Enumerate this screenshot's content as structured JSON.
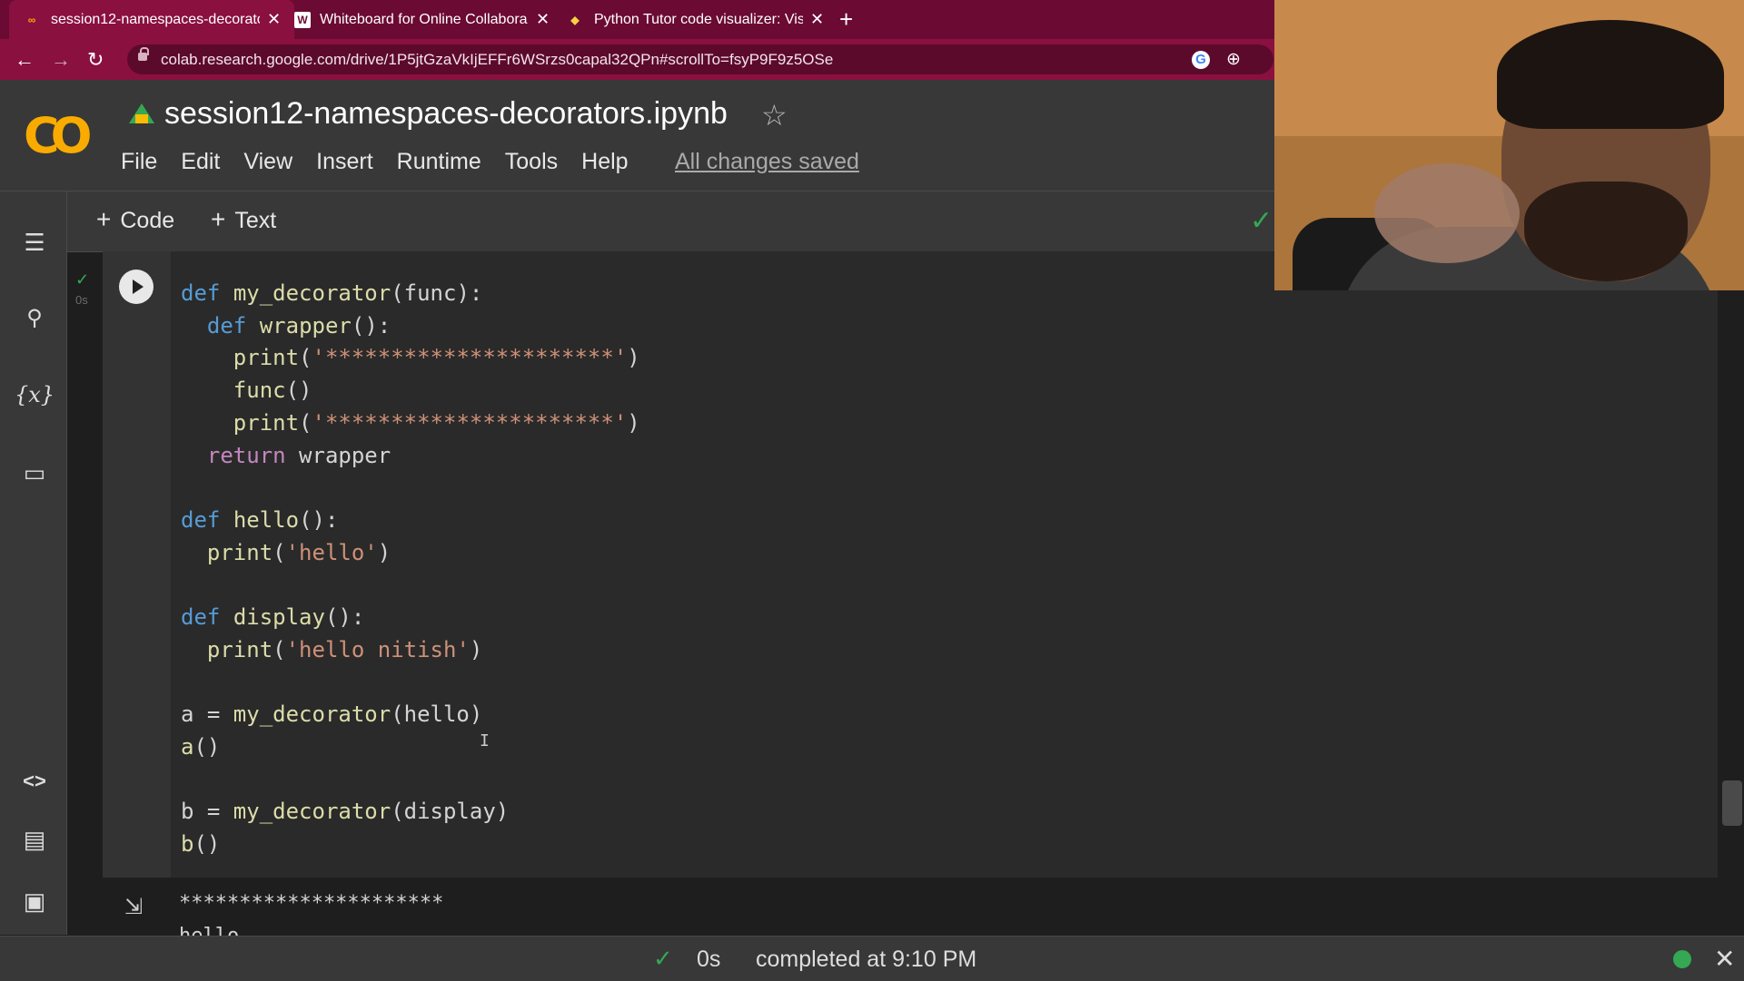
{
  "browser": {
    "tabs": [
      {
        "title": "session12-namespaces-decorato",
        "favicon": "colab-icon",
        "active": true
      },
      {
        "title": "Whiteboard for Online Collabora",
        "favicon": "whiteboard-icon",
        "active": false
      },
      {
        "title": "Python Tutor code visualizer: Vis",
        "favicon": "python-icon",
        "active": false
      }
    ],
    "new_tab": "+",
    "url": "colab.research.google.com/drive/1P5jtGzaVkIjEFFr6WSrzs0capal32QPn#scrollTo=fsyP9F9z5OSe",
    "accent": "#8a1040"
  },
  "colab": {
    "logo_text": "CO",
    "notebook_title": "session12-namespaces-decorators.ipynb",
    "menu": [
      "File",
      "Edit",
      "View",
      "Insert",
      "Runtime",
      "Tools",
      "Help"
    ],
    "save_status": "All changes saved",
    "toolbar": {
      "code_label": "Code",
      "text_label": "Text"
    }
  },
  "cell": {
    "exec_time": "0s",
    "code_lines": [
      "def my_decorator(func):",
      "  def wrapper():",
      "    print('**********************')",
      "    func()",
      "    print('**********************')",
      "  return wrapper",
      "",
      "def hello():",
      "  print('hello')",
      "",
      "def display():",
      "  print('hello nitish')",
      "",
      "a = my_decorator(hello)",
      "a()",
      "",
      "b = my_decorator(display)",
      "b()"
    ],
    "output_lines": [
      "**********************",
      "hello"
    ]
  },
  "status": {
    "time": "0s",
    "completed": "completed at 9:10 PM",
    "connected_color": "#34a853"
  }
}
